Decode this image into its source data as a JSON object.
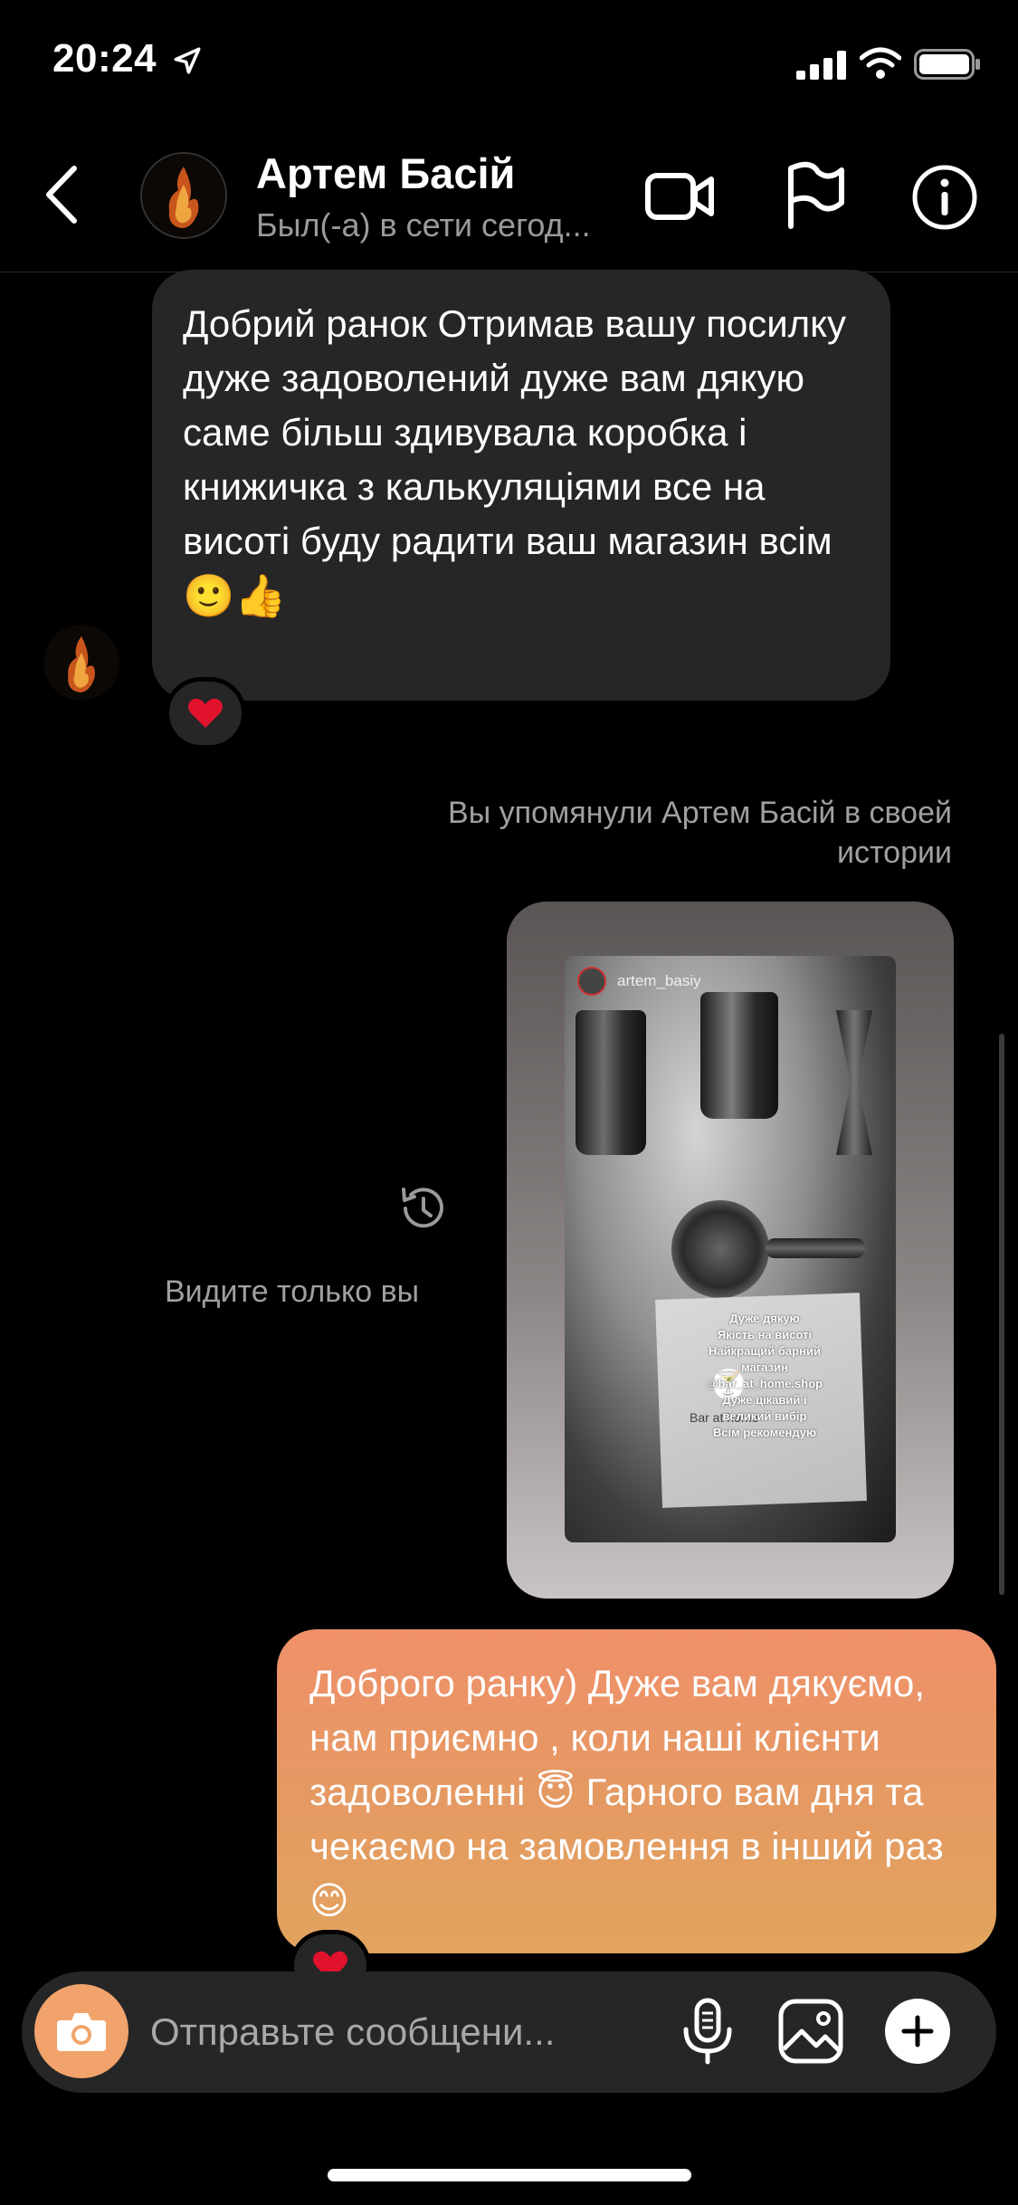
{
  "status_bar": {
    "time": "20:24"
  },
  "header": {
    "contact_name": "Артем Басій",
    "contact_status": "Был(-а) в сети сегод..."
  },
  "incoming_message": {
    "text": "Добрий ранок Отримав вашу посилку дуже задоволений дуже вам дякую саме більш здивувала коробка і книжичка з калькуляціями все на висоті буду радити ваш магазин всім",
    "emoji": "🙂👍",
    "reaction": "heart"
  },
  "mention_note": "Вы упомянули Артем Басій в своей истории",
  "story": {
    "username": "artem_basiy",
    "lines": [
      "Дуже дякую",
      "Якість на висоті",
      "Найкращий барний",
      "магазин",
      "@bar_at_home.shop",
      "Дуже цікавий і",
      "великий вибір",
      "Всім рекомендую"
    ],
    "brand": "Bar at home",
    "visibility_note": "Видите только вы"
  },
  "outgoing_message": {
    "text": "Доброго ранку) Дуже вам дякуємо, нам приємно , коли наші клієнти задоволенні 😇 Гарного вам дня та чекаємо на замовлення в інший раз 😊",
    "reaction": "heart"
  },
  "composer": {
    "placeholder": "Отправьте сообщени..."
  },
  "colors": {
    "background": "#000000",
    "incoming_bubble": "#262626",
    "outgoing_bubble": "#e49a62",
    "camera_button": "#f2a36b"
  }
}
